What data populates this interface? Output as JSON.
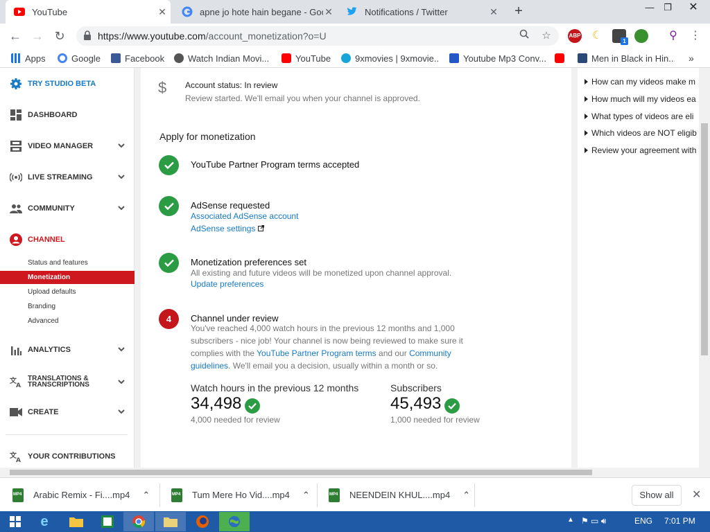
{
  "browser": {
    "tabs": [
      {
        "title": "YouTube",
        "active": true
      },
      {
        "title": "apne jo hote hain begane - Goog",
        "active": false
      },
      {
        "title": "Notifications / Twitter",
        "active": false
      }
    ],
    "url_host": "https://www.youtube.com",
    "url_path": "/account_monetization?o=U",
    "extensions": {
      "abp": "ABP",
      "badge": "1"
    },
    "bookmarks": [
      "Apps",
      "Google",
      "Facebook",
      "Watch Indian Movi...",
      "YouTube",
      "9xmovies | 9xmovie...",
      "Youtube Mp3 Conv...",
      "Men in Black in Hin..."
    ],
    "more": "»"
  },
  "sidebar": {
    "studio": "TRY STUDIO BETA",
    "items": [
      "DASHBOARD",
      "VIDEO MANAGER",
      "LIVE STREAMING",
      "COMMUNITY",
      "CHANNEL",
      "ANALYTICS",
      "TRANSLATIONS & TRANSCRIPTIONS",
      "CREATE",
      "YOUR CONTRIBUTIONS"
    ],
    "translations_line1": "TRANSLATIONS &",
    "translations_line2": "TRANSCRIPTIONS",
    "subitems": [
      "Status and features",
      "Monetization",
      "Upload defaults",
      "Branding",
      "Advanced"
    ],
    "selected": "Monetization"
  },
  "main": {
    "account_status": "Account status: In review",
    "account_sub": "Review started. We'll email you when your channel is approved.",
    "apply_heading": "Apply for monetization",
    "steps": [
      {
        "title": "YouTube Partner Program terms accepted"
      },
      {
        "title": "AdSense requested",
        "link1": "Associated AdSense account",
        "link2": "AdSense settings"
      },
      {
        "title": "Monetization preferences set",
        "body": "All existing and future videos will be monetized upon channel approval.",
        "link1": "Update preferences"
      },
      {
        "number": "4",
        "title": "Channel under review",
        "body_a": "You've reached 4,000 watch hours in the previous 12 months and 1,000 subscribers - nice job! Your channel is now being reviewed to make sure it complies with the ",
        "link_a": "YouTube Partner Program terms",
        "body_b": " and our ",
        "link_b": "Community guidelines",
        "body_c": ". We'll email you a decision, usually within a month or so."
      }
    ],
    "stats": [
      {
        "label": "Watch hours in the previous 12 months",
        "value": "34,498",
        "sub": "4,000 needed for review"
      },
      {
        "label": "Subscribers",
        "value": "45,493",
        "sub": "1,000 needed for review"
      }
    ]
  },
  "help_links": [
    "How can my videos make m",
    "How much will my videos ea",
    "What types of videos are eli",
    "Which videos are NOT eligib",
    "Review your agreement with"
  ],
  "downloads": {
    "items": [
      "Arabic Remix - Fi....mp4",
      "Tum Mere Ho Vid....mp4",
      "NEENDEIN KHUL....mp4"
    ],
    "show_all": "Show all"
  },
  "taskbar": {
    "lang": "ENG",
    "time": "7:01 PM"
  },
  "colors": {
    "accent_red": "#cc181e",
    "success": "#2c9c44",
    "link": "#167ac6",
    "taskbar": "#1f5aa6"
  }
}
